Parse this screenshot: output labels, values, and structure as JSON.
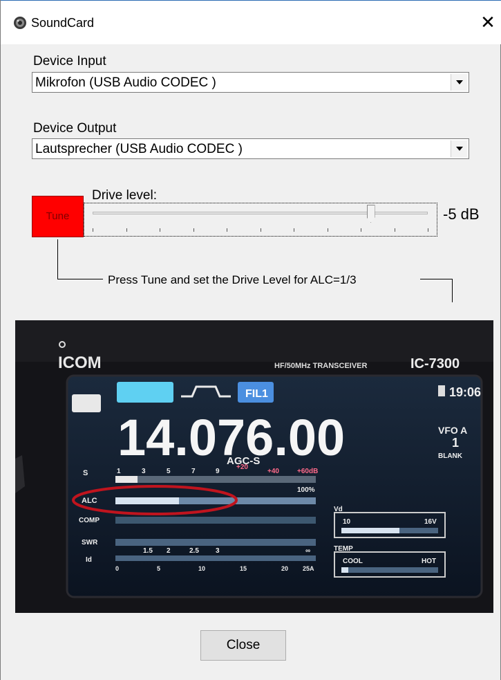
{
  "window": {
    "title": "SoundCard",
    "close_glyph": "✕",
    "icon": "speaker-icon"
  },
  "device_input": {
    "label": "Device Input",
    "value": "Mikrofon (USB Audio CODEC )"
  },
  "device_output": {
    "label": "Device Output",
    "value": "Lautsprecher (USB Audio CODEC )"
  },
  "tune": {
    "button_label": "Tune",
    "color": "#ff0000"
  },
  "drive": {
    "label": "Drive level:",
    "value_text": "-5 dB",
    "position_fraction": 0.83
  },
  "hint": "Press Tune and set the Drive Level for ALC=1/3",
  "radio_photo": {
    "brand": "ICOM",
    "model_text": "HF/50MHz TRANSCEIVER",
    "model": "IC-7300",
    "clock": "19:06",
    "frequency": "14.076.00",
    "filter": "FIL1",
    "agc": "AGC-S",
    "vfo": "VFO A",
    "vfo_num": "1",
    "blank": "BLANK",
    "meter_labels": [
      "S",
      "ALC",
      "COMP",
      "SWR",
      "Id"
    ],
    "s_scale": [
      "1",
      "3",
      "5",
      "7",
      "9",
      "+20",
      "+40",
      "+60dB"
    ],
    "po_scale": "100%",
    "swr_scale": [
      "1.5",
      "2",
      "2.5",
      "3",
      "∞"
    ],
    "id_scale": [
      "0",
      "5",
      "10",
      "15",
      "20",
      "25A"
    ],
    "vd_label": "Vd",
    "vd_min": "10",
    "vd_max": "16V",
    "temp_label": "TEMP",
    "temp_cool": "COOL",
    "temp_hot": "HOT",
    "highlight_color": "#c0141e"
  },
  "close_button": "Close"
}
